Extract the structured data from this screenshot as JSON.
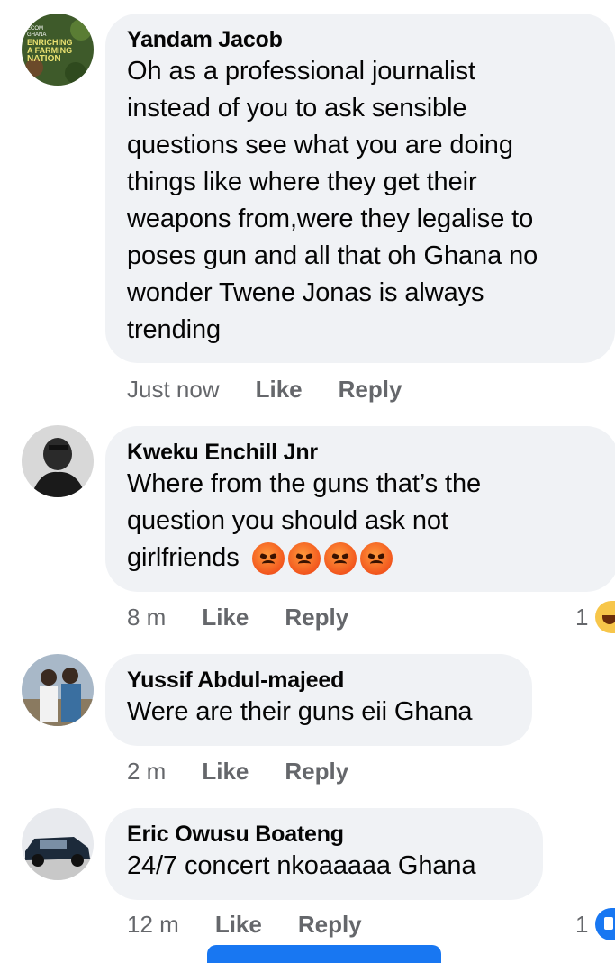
{
  "comments": [
    {
      "author": "Yandam Jacob",
      "text_lines": [
        "Oh as a professional journalist",
        "instead of you to ask sensible",
        "questions see what you are doing",
        "things like where they get their",
        "weapons from,were they legalise to",
        "poses gun and all that oh Ghana no",
        "wonder Twene Jonas is always",
        "trending"
      ],
      "time": "Just now",
      "like": "Like",
      "reply": "Reply",
      "avatar_text": [
        "ECOM",
        "GHANA",
        "ENRICHING",
        "A FARMING",
        "NATION"
      ]
    },
    {
      "author": "Kweku Enchill Jnr",
      "text_lines": [
        "Where from the guns that’s the",
        "question you should ask not",
        "girlfriends"
      ],
      "emoji": [
        "angry-face",
        "angry-face",
        "angry-face",
        "angry-face"
      ],
      "time": "8 m",
      "like": "Like",
      "reply": "Reply",
      "reaction_count": "1",
      "reaction_icon": "haha-icon"
    },
    {
      "author": "Yussif Abdul-majeed",
      "text_lines": [
        "Were are their guns eii Ghana"
      ],
      "time": "2 m",
      "like": "Like",
      "reply": "Reply"
    },
    {
      "author": "Eric Owusu Boateng",
      "text_lines": [
        "24/7 concert nkoaaaaa Ghana"
      ],
      "time": "12 m",
      "like": "Like",
      "reply": "Reply",
      "reaction_count": "1",
      "reaction_icon": "like-icon"
    }
  ],
  "colors": {
    "bubble": "#f0f2f5",
    "meta": "#65676b",
    "text": "#050505",
    "accent": "#1877f2"
  }
}
